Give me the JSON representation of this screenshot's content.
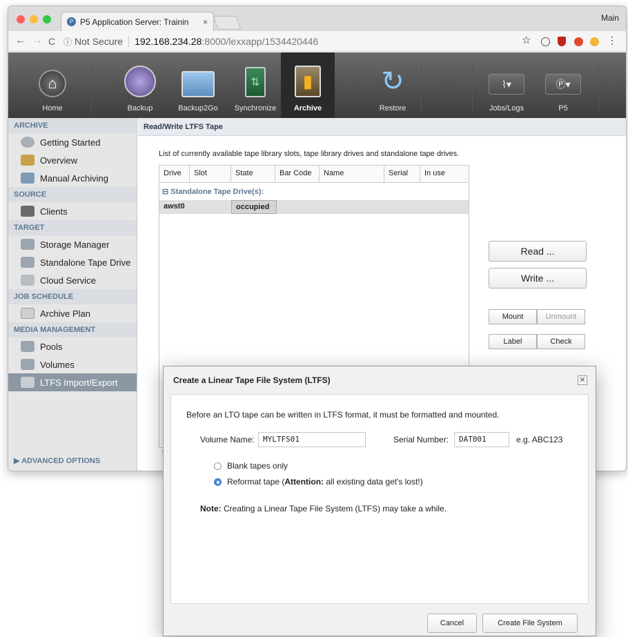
{
  "browser": {
    "tab_title": "P5 Application Server: Trainin",
    "tab_close": "×",
    "profile": "Main",
    "url_info": "ⓘ",
    "url_notsecure": "Not Secure",
    "url_host": "192.168.234.28",
    "url_path": ":8000/lexxapp/1534420446",
    "back": "←",
    "forward": "→",
    "reload": "C",
    "star": "☆"
  },
  "nav": {
    "home": "Home",
    "backup": "Backup",
    "backup2go": "Backup2Go",
    "synchronize": "Synchronize",
    "archive": "Archive",
    "restore": "Restore",
    "jobslogs": "Jobs/Logs",
    "p5": "P5"
  },
  "sidebar": {
    "archive_header": "ARCHIVE",
    "getting_started": "Getting Started",
    "overview": "Overview",
    "manual_archiving": "Manual Archiving",
    "source_header": "SOURCE",
    "clients": "Clients",
    "target_header": "TARGET",
    "storage_manager": "Storage Manager",
    "standalone_tape_drive": "Standalone Tape Drive",
    "cloud_service": "Cloud Service",
    "job_schedule_header": "JOB SCHEDULE",
    "archive_plan": "Archive Plan",
    "media_management_header": "MEDIA MANAGEMENT",
    "pools": "Pools",
    "volumes": "Volumes",
    "ltfs_import_export": "LTFS Import/Export",
    "advanced_options": "▶ ADVANCED OPTIONS"
  },
  "main": {
    "title": "Read/Write LTFS Tape",
    "description": "List of currently available tape library slots, tape library drives and standalone tape drives.",
    "columns": [
      "Drive",
      "Slot",
      "State",
      "Bar Code",
      "Name",
      "Serial",
      "In use"
    ],
    "group_label": "⊟ Standalone Tape Drive(s):",
    "row": {
      "drive": "awst0",
      "state": "occupied"
    },
    "refresh": "↻",
    "read_button": "Read ...",
    "write_button": "Write ...",
    "mount_button": "Mount",
    "unmount_button": "Unmount",
    "label_button": "Label",
    "check_button": "Check"
  },
  "dialog": {
    "title": "Create a Linear Tape File System (LTFS)",
    "close": "✕",
    "intro": "Before an LTO tape can be written in LTFS format, it must be formatted and mounted.",
    "volume_name_label": "Volume Name:",
    "volume_name_value": "MYLTFS01",
    "serial_number_label": "Serial Number:",
    "serial_number_value": "DAT001",
    "serial_example": "e.g. ABC123",
    "blank_tapes_label": "Blank tapes only",
    "reformat_label_prefix": "Reformat tape (",
    "reformat_attention": "Attention:",
    "reformat_label_suffix": " all existing data get's lost!)",
    "note_bold": "Note:",
    "note_text": " Creating a Linear Tape File System (LTFS) may take a while.",
    "cancel_button": "Cancel",
    "create_button": "Create File System"
  },
  "colors": {
    "accent": "#5d7893",
    "header_dark": "#3d3d3d",
    "sidebar_active": "#8b97a3"
  }
}
